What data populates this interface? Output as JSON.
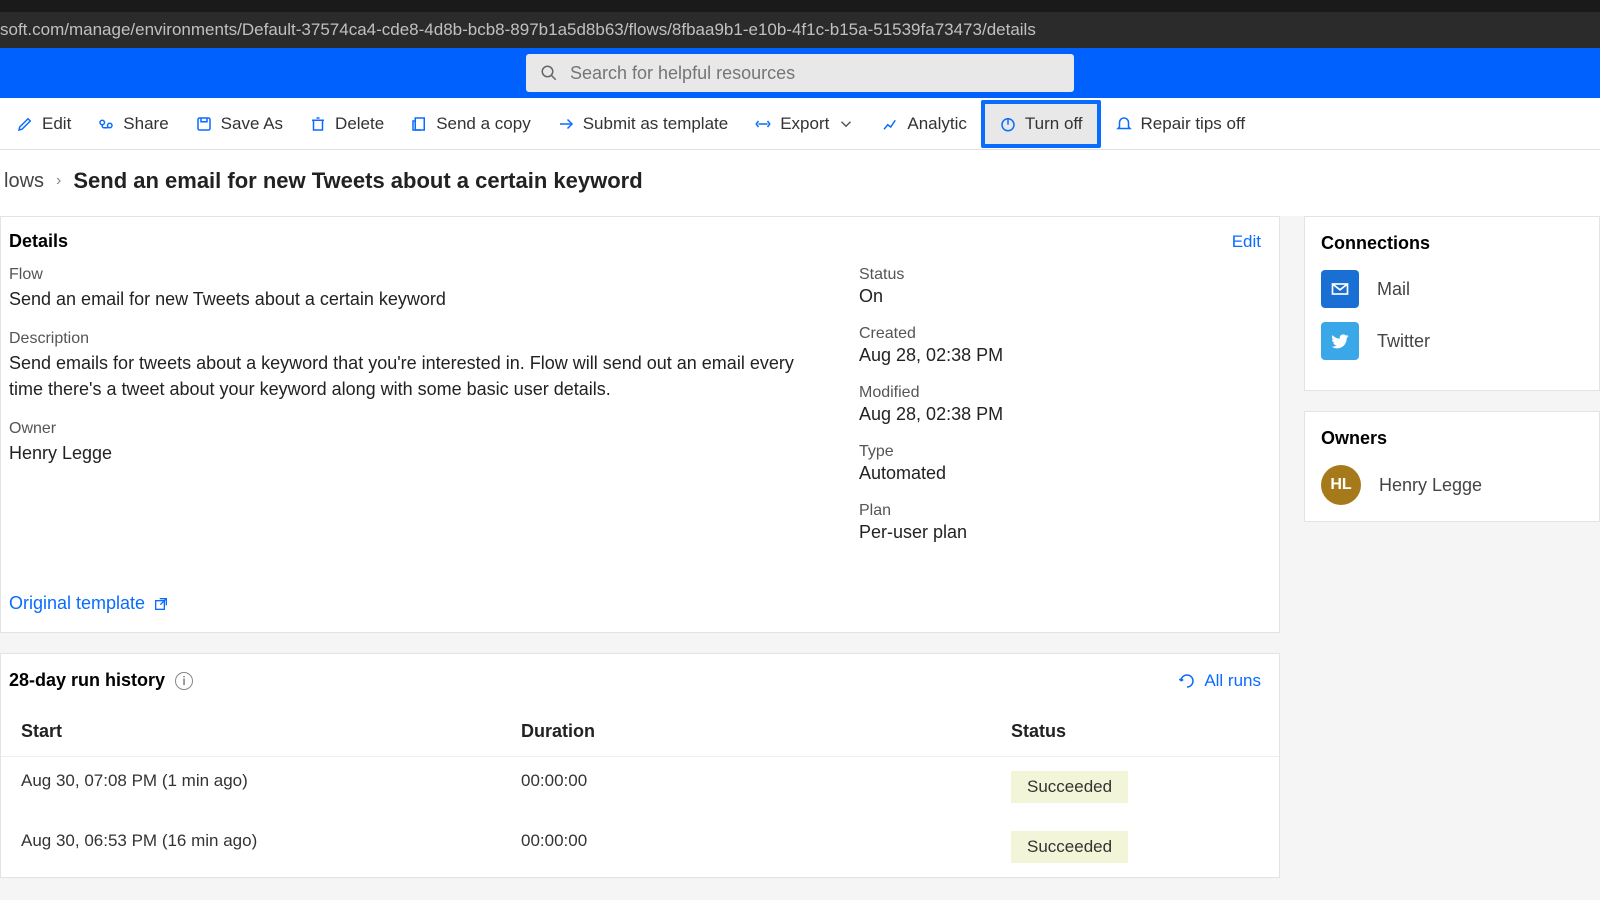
{
  "url": "soft.com/manage/environments/Default-37574ca4-cde8-4d8b-bcb8-897b1a5d8b63/flows/8fbaa9b1-e10b-4f1c-b15a-51539fa73473/details",
  "search": {
    "placeholder": "Search for helpful resources"
  },
  "toolbar": {
    "edit": "Edit",
    "share": "Share",
    "saveas": "Save As",
    "delete": "Delete",
    "sendcopy": "Send a copy",
    "submit": "Submit as template",
    "export": "Export",
    "analytics": "Analytic",
    "turnoff": "Turn off",
    "repair": "Repair tips off"
  },
  "breadcrumb": {
    "root": "lows",
    "title": "Send an email for new Tweets about a certain keyword"
  },
  "details": {
    "header": "Details",
    "edit": "Edit",
    "flow_label": "Flow",
    "flow_value": "Send an email for new Tweets about a certain keyword",
    "desc_label": "Description",
    "desc_value": "Send emails for tweets about a keyword that you're interested in. Flow will send out an email every time there's a tweet about your keyword along with some basic user details.",
    "owner_label": "Owner",
    "owner_value": "Henry Legge",
    "status_label": "Status",
    "status_value": "On",
    "created_label": "Created",
    "created_value": "Aug 28, 02:38 PM",
    "modified_label": "Modified",
    "modified_value": "Aug 28, 02:38 PM",
    "type_label": "Type",
    "type_value": "Automated",
    "plan_label": "Plan",
    "plan_value": "Per-user plan",
    "orig_template": "Original template"
  },
  "runs": {
    "header": "28-day run history",
    "all_runs": "All runs",
    "col_start": "Start",
    "col_duration": "Duration",
    "col_status": "Status",
    "rows": [
      {
        "start": "Aug 30, 07:08 PM (1 min ago)",
        "duration": "00:00:00",
        "status": "Succeeded"
      },
      {
        "start": "Aug 30, 06:53 PM (16 min ago)",
        "duration": "00:00:00",
        "status": "Succeeded"
      }
    ]
  },
  "connections": {
    "header": "Connections",
    "items": [
      {
        "label": "Mail"
      },
      {
        "label": "Twitter"
      }
    ]
  },
  "owners": {
    "header": "Owners",
    "initials": "HL",
    "name": "Henry Legge"
  }
}
